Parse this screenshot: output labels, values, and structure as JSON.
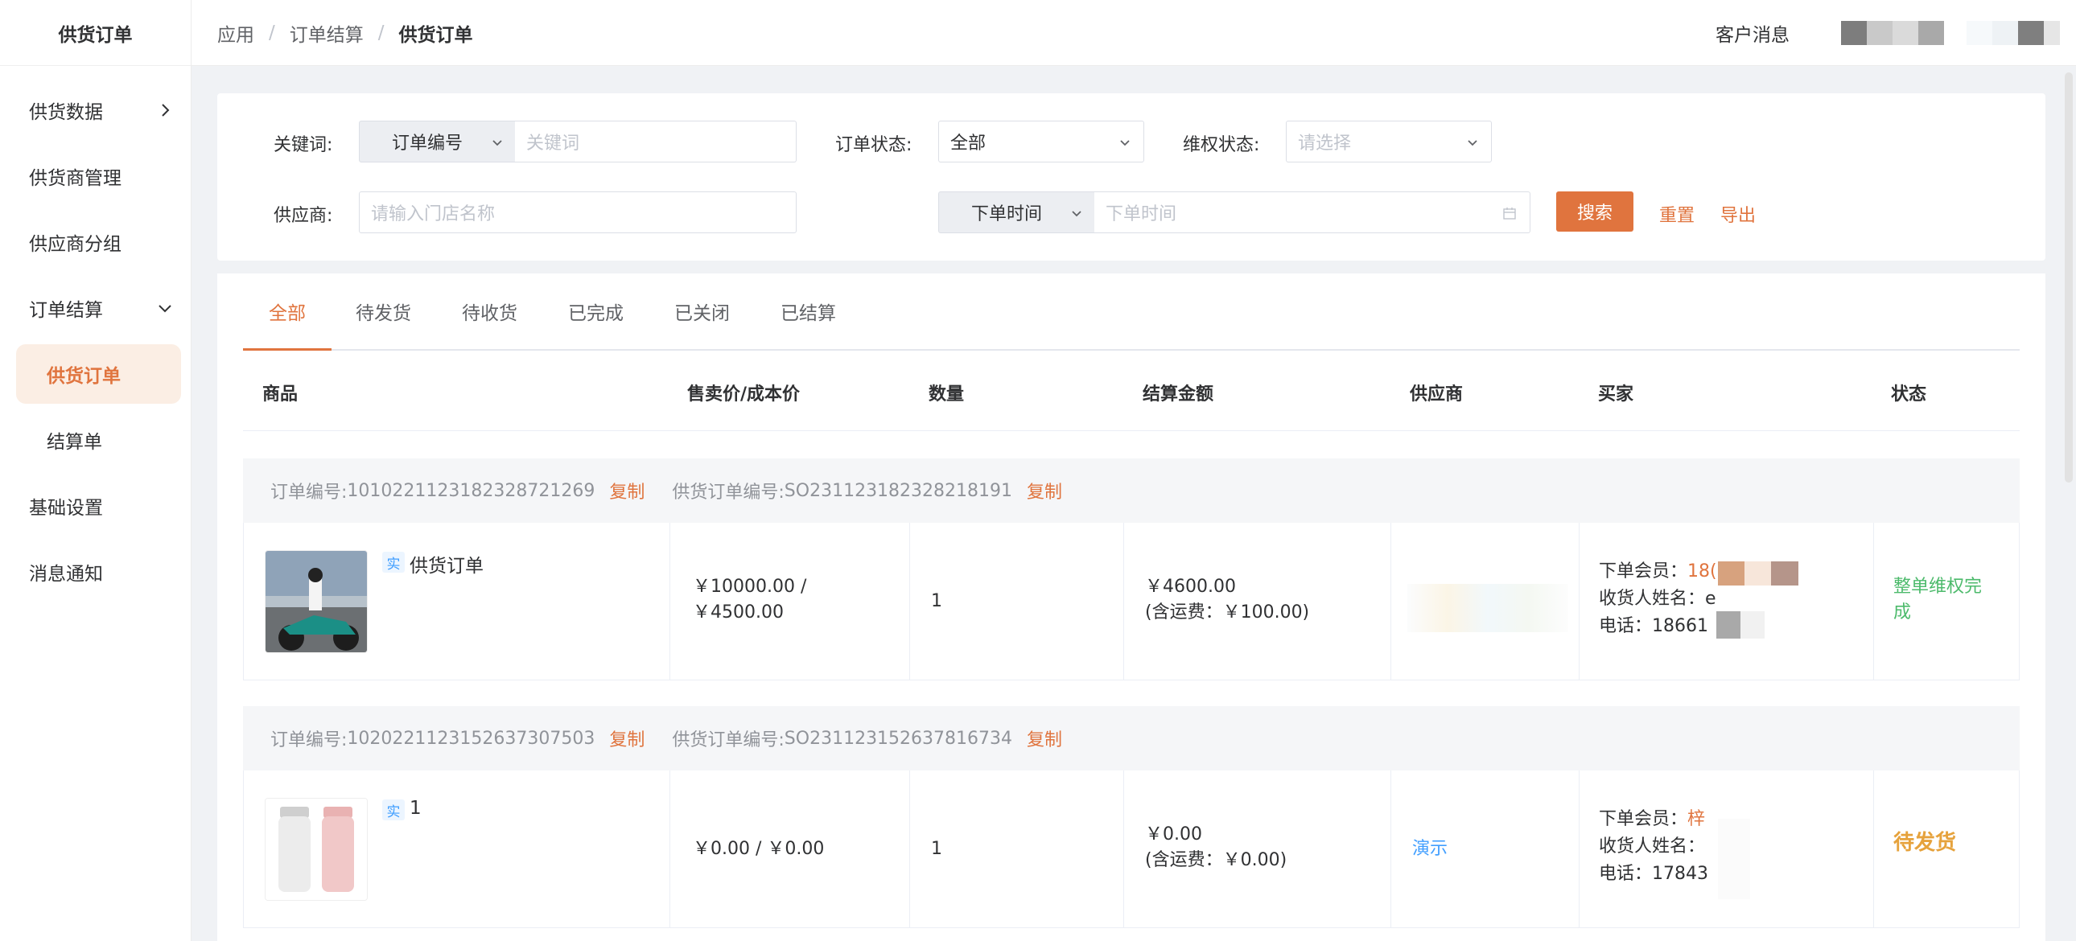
{
  "app": {
    "brand": "供货订单",
    "breadcrumb": [
      "应用",
      "订单结算",
      "供货订单"
    ],
    "header_right": "客户消息"
  },
  "sidebar": {
    "items": [
      {
        "label": "供货数据",
        "chevron": "right"
      },
      {
        "label": "供货商管理"
      },
      {
        "label": "供应商分组"
      },
      {
        "label": "订单结算",
        "chevron": "down",
        "children": [
          {
            "label": "供货订单",
            "active": true
          },
          {
            "label": "结算单"
          }
        ]
      },
      {
        "label": "基础设置"
      },
      {
        "label": "消息通知"
      }
    ]
  },
  "filters": {
    "keyword_label": "关键词:",
    "keyword_type": "订单编号",
    "keyword_placeholder": "关键词",
    "order_status_label": "订单状态:",
    "order_status_value": "全部",
    "rights_status_label": "维权状态:",
    "rights_status_placeholder": "请选择",
    "supplier_label": "供应商:",
    "supplier_placeholder": "请输入门店名称",
    "time_type": "下单时间",
    "time_placeholder": "下单时间",
    "search_button": "搜索",
    "reset_button": "重置",
    "export_button": "导出"
  },
  "tabs": [
    "全部",
    "待发货",
    "待收货",
    "已完成",
    "已关闭",
    "已结算"
  ],
  "table": {
    "columns": [
      "商品",
      "售卖价/成本价",
      "数量",
      "结算金额",
      "供应商",
      "买家",
      "状态"
    ]
  },
  "orders": [
    {
      "order_no_label": "订单编号:",
      "order_no": "1010221123182328721269",
      "copy": "复制",
      "supply_no_label": "供货订单编号:",
      "supply_no": "SO231123182328218191",
      "tag": "实",
      "goods_name": "供货订单",
      "price_line1": "￥10000.00 /",
      "price_line2": "￥4500.00",
      "quantity": "1",
      "amount_line1": "￥4600.00",
      "amount_line2": "(含运费：￥100.00)",
      "supplier": "",
      "buyer_member_label": "下单会员：",
      "buyer_member": "18(",
      "buyer_name_label": "收货人姓名：",
      "buyer_name": "e",
      "buyer_phone_label": "电话：",
      "buyer_phone": "18661",
      "status": "整单维权完成"
    },
    {
      "order_no_label": "订单编号:",
      "order_no": "1020221123152637307503",
      "copy": "复制",
      "supply_no_label": "供货订单编号:",
      "supply_no": "SO231123152637816734",
      "tag": "实",
      "goods_name": "1",
      "price_line1": "￥0.00 / ￥0.00",
      "price_line2": "",
      "quantity": "1",
      "amount_line1": "￥0.00",
      "amount_line2": "(含运费：￥0.00)",
      "supplier": "演示",
      "buyer_member_label": "下单会员：",
      "buyer_member": "梓",
      "buyer_name_label": "收货人姓名：",
      "buyer_name": "",
      "buyer_phone_label": "电话：",
      "buyer_phone": "17843",
      "status": "待发货"
    }
  ],
  "colors": {
    "accent": "#e0743e",
    "success": "#4cba6b",
    "warning": "#e6a23c",
    "link": "#409eff"
  }
}
